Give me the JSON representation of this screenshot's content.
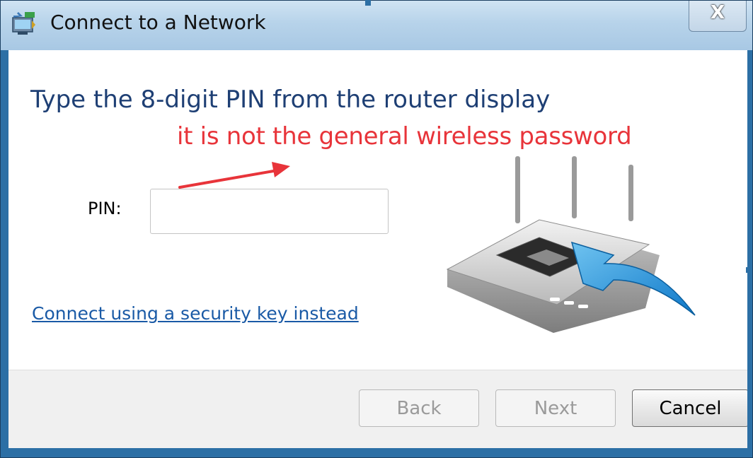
{
  "window": {
    "title": "Connect to a Network",
    "close_label": "X"
  },
  "main": {
    "heading": "Type the 8-digit PIN from the router display",
    "annotation": "it is not the general wireless password",
    "pin_label": "PIN:",
    "pin_value": "",
    "alt_link": "Connect using a security key instead"
  },
  "footer": {
    "back_label": "Back",
    "next_label": "Next",
    "cancel_label": "Cancel"
  },
  "colors": {
    "heading": "#1e3f74",
    "annotation": "#e8343a",
    "link": "#1a5aa6",
    "frame": "#2c6fa5"
  },
  "icons": [
    "network-icon",
    "close-icon",
    "annotation-arrow-icon",
    "router-illustration-icon"
  ]
}
